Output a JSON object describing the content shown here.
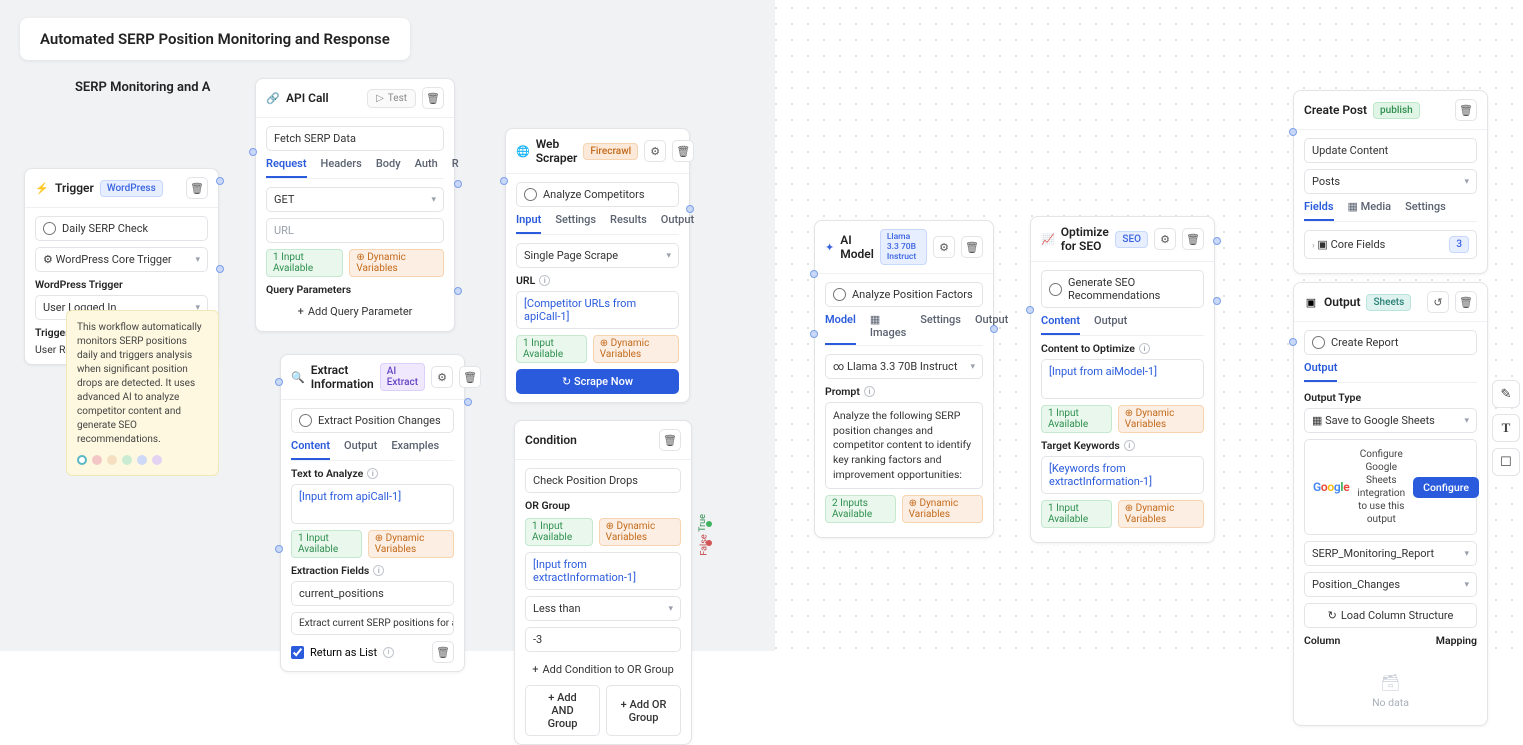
{
  "page_title": "Automated SERP Position Monitoring and Response",
  "subtitle": "SERP Monitoring and A",
  "tooltip": {
    "text": "This workflow automatically monitors SERP positions daily and triggers analysis when significant position drops are detected. It uses advanced AI to analyze competitor content and generate SEO recommendations."
  },
  "trigger": {
    "title": "Trigger",
    "badge": "WordPress",
    "option": "Daily SERP Check",
    "core": "WordPress Core Trigger",
    "wp_trigger_label": "WordPress Trigger",
    "wp_trigger_value": "User Logged In",
    "trigger_cond_label": "Trigger Co",
    "user_role_label": "User Role"
  },
  "api": {
    "title": "API Call",
    "test": "Test",
    "name": "Fetch SERP Data",
    "tabs": [
      "Request",
      "Headers",
      "Body",
      "Auth",
      "R"
    ],
    "method": "GET",
    "url_placeholder": "URL",
    "input_chip": "1 Input Available",
    "var_chip": "Dynamic Variables",
    "qp_label": "Query Parameters",
    "add_qp": "Add Query Parameter"
  },
  "extract": {
    "title": "Extract Information",
    "badge": "AI Extract",
    "name": "Extract Position Changes",
    "tabs": [
      "Content",
      "Output",
      "Examples"
    ],
    "text_label": "Text to Analyze",
    "text_val": "[Input from apiCall-1]",
    "input_chip": "1 Input Available",
    "var_chip": "Dynamic Variables",
    "fields_label": "Extraction Fields",
    "field_key": "current_positions",
    "field_desc": "Extract current SERP positions for all keywor",
    "return_list": "Return as List"
  },
  "scraper": {
    "title": "Web Scraper",
    "badge": "Firecrawl",
    "name": "Analyze Competitors",
    "tabs": [
      "Input",
      "Settings",
      "Results",
      "Output"
    ],
    "mode": "Single Page Scrape",
    "url_label": "URL",
    "url_val": "[Competitor URLs from apiCall-1]",
    "input_chip": "1 Input Available",
    "var_chip": "Dynamic Variables",
    "scrape_btn": "Scrape Now"
  },
  "condition": {
    "title": "Condition",
    "name": "Check Position Drops",
    "or_label": "OR Group",
    "input_chip": "1 Input Available",
    "var_chip": "Dynamic Variables",
    "left": "[Input from extractInformation-1]",
    "op": "Less than",
    "right": "-3",
    "add_or": "Add Condition to OR Group",
    "add_and_btn": "Add AND Group",
    "add_or_btn": "Add OR Group",
    "true": "True",
    "false": "False"
  },
  "ai": {
    "title": "AI Model",
    "badge": "Llama 3.3 70B Instruct",
    "name": "Analyze Position Factors",
    "tabs": [
      "Model",
      "Images",
      "Settings",
      "Output"
    ],
    "model": "Llama 3.3 70B Instruct",
    "prompt_label": "Prompt",
    "prompt_text": "Analyze the following SERP position changes and competitor content to identify key ranking factors and improvement opportunities:",
    "input_chip": "2 Inputs Available",
    "var_chip": "Dynamic Variables"
  },
  "seo": {
    "title": "Optimize for SEO",
    "badge": "SEO",
    "name": "Generate SEO Recommendations",
    "tabs": [
      "Content",
      "Output"
    ],
    "content_label": "Content to Optimize",
    "content_val": "[Input from aiModel-1]",
    "input_chip": "1 Input Available",
    "var_chip": "Dynamic Variables",
    "kw_label": "Target Keywords",
    "kw_val": "[Keywords from extractInformation-1]",
    "input_chip2": "1 Input Available",
    "var_chip2": "Dynamic Variables"
  },
  "post": {
    "title": "Create Post",
    "badge": "publish",
    "name": "Update Content",
    "type": "Posts",
    "tabs": [
      "Fields",
      "Media",
      "Settings"
    ],
    "core_fields": "Core Fields",
    "core_count": "3"
  },
  "output": {
    "title": "Output",
    "badge": "Sheets",
    "name": "Create Report",
    "tab": "Output",
    "type_label": "Output Type",
    "type_val": "Save to Google Sheets",
    "gs_text": "Configure Google Sheets integration to use this output",
    "configure": "Configure",
    "sheet": "SERP_Monitoring_Report",
    "tab_name": "Position_Changes",
    "load_cols": "Load Column Structure",
    "col": "Column",
    "map": "Mapping",
    "nodata": "No data"
  }
}
